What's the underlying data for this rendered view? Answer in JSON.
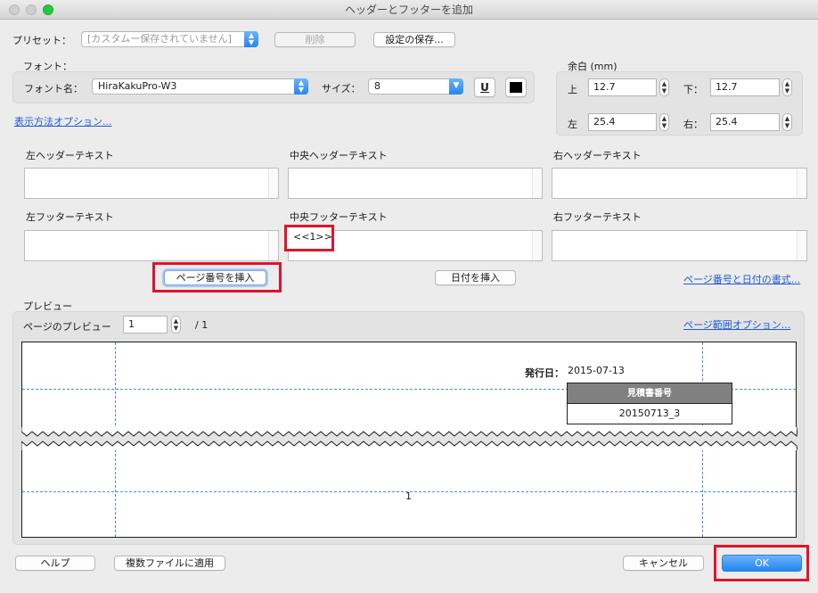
{
  "window": {
    "title": "ヘッダーとフッターを追加"
  },
  "preset": {
    "label": "プリセット：",
    "value": "[カスタムー保存されていません]",
    "delete_button": "削除",
    "save_settings_button": "設定の保存..."
  },
  "font": {
    "section_label": "フォント：",
    "name_label": "フォント名：",
    "name_value": "HiraKakuPro-W3",
    "size_label": "サイズ：",
    "size_value": "8",
    "underline_button": "U"
  },
  "margin": {
    "section_label": "余白 (mm)",
    "top_label": "上",
    "top_value": "12.7",
    "bottom_label": "下：",
    "bottom_value": "12.7",
    "left_label": "左",
    "left_value": "25.4",
    "right_label": "右：",
    "right_value": "25.4"
  },
  "display_options_link": "表示方法オプション...",
  "text_fields": {
    "left_header": "左ヘッダーテキスト",
    "center_header": "中央ヘッダーテキスト",
    "right_header": "右ヘッダーテキスト",
    "left_footer": "左フッターテキスト",
    "center_footer": "中央フッターテキスト",
    "right_footer": "右フッターテキスト",
    "center_footer_value": "<<1>>"
  },
  "insert_page_number_button": "ページ番号を挿入",
  "insert_date_button": "日付を挿入",
  "page_number_date_format_link": "ページ番号と日付の書式...",
  "preview": {
    "section_label": "プレビュー",
    "page_preview_label": "ページのプレビュー",
    "page_value": "1",
    "page_total": "/ 1",
    "page_range_link": "ページ範囲オプション...",
    "issue_date_label": "発行日：",
    "issue_date_value": "2015-07-13",
    "estimate_header": "見積書番号",
    "estimate_value": "20150713_3",
    "footer_page_number": "1"
  },
  "footer_buttons": {
    "help": "ヘルプ",
    "apply_multiple": "複数ファイルに適用",
    "cancel": "キャンセル",
    "ok": "OK"
  },
  "colors": {
    "accent": "#2485f3",
    "link": "#1f5bd6",
    "highlight": "#e0142b",
    "guide": "#4a8fd6"
  },
  "icons": [
    "close-icon",
    "minimize-icon",
    "zoom-icon",
    "chevron-updown-icon",
    "chevron-down-icon",
    "stepper-icon",
    "color-swatch-icon"
  ]
}
